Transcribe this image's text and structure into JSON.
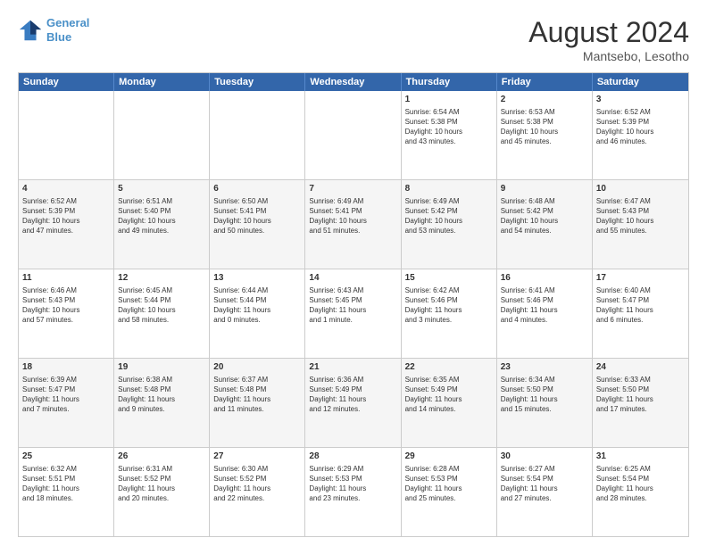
{
  "logo": {
    "line1": "General",
    "line2": "Blue"
  },
  "header": {
    "month_year": "August 2024",
    "location": "Mantsebo, Lesotho"
  },
  "days": [
    "Sunday",
    "Monday",
    "Tuesday",
    "Wednesday",
    "Thursday",
    "Friday",
    "Saturday"
  ],
  "rows": [
    [
      {
        "day": "",
        "content": ""
      },
      {
        "day": "",
        "content": ""
      },
      {
        "day": "",
        "content": ""
      },
      {
        "day": "",
        "content": ""
      },
      {
        "day": "1",
        "content": "Sunrise: 6:54 AM\nSunset: 5:38 PM\nDaylight: 10 hours\nand 43 minutes."
      },
      {
        "day": "2",
        "content": "Sunrise: 6:53 AM\nSunset: 5:38 PM\nDaylight: 10 hours\nand 45 minutes."
      },
      {
        "day": "3",
        "content": "Sunrise: 6:52 AM\nSunset: 5:39 PM\nDaylight: 10 hours\nand 46 minutes."
      }
    ],
    [
      {
        "day": "4",
        "content": "Sunrise: 6:52 AM\nSunset: 5:39 PM\nDaylight: 10 hours\nand 47 minutes."
      },
      {
        "day": "5",
        "content": "Sunrise: 6:51 AM\nSunset: 5:40 PM\nDaylight: 10 hours\nand 49 minutes."
      },
      {
        "day": "6",
        "content": "Sunrise: 6:50 AM\nSunset: 5:41 PM\nDaylight: 10 hours\nand 50 minutes."
      },
      {
        "day": "7",
        "content": "Sunrise: 6:49 AM\nSunset: 5:41 PM\nDaylight: 10 hours\nand 51 minutes."
      },
      {
        "day": "8",
        "content": "Sunrise: 6:49 AM\nSunset: 5:42 PM\nDaylight: 10 hours\nand 53 minutes."
      },
      {
        "day": "9",
        "content": "Sunrise: 6:48 AM\nSunset: 5:42 PM\nDaylight: 10 hours\nand 54 minutes."
      },
      {
        "day": "10",
        "content": "Sunrise: 6:47 AM\nSunset: 5:43 PM\nDaylight: 10 hours\nand 55 minutes."
      }
    ],
    [
      {
        "day": "11",
        "content": "Sunrise: 6:46 AM\nSunset: 5:43 PM\nDaylight: 10 hours\nand 57 minutes."
      },
      {
        "day": "12",
        "content": "Sunrise: 6:45 AM\nSunset: 5:44 PM\nDaylight: 10 hours\nand 58 minutes."
      },
      {
        "day": "13",
        "content": "Sunrise: 6:44 AM\nSunset: 5:44 PM\nDaylight: 11 hours\nand 0 minutes."
      },
      {
        "day": "14",
        "content": "Sunrise: 6:43 AM\nSunset: 5:45 PM\nDaylight: 11 hours\nand 1 minute."
      },
      {
        "day": "15",
        "content": "Sunrise: 6:42 AM\nSunset: 5:46 PM\nDaylight: 11 hours\nand 3 minutes."
      },
      {
        "day": "16",
        "content": "Sunrise: 6:41 AM\nSunset: 5:46 PM\nDaylight: 11 hours\nand 4 minutes."
      },
      {
        "day": "17",
        "content": "Sunrise: 6:40 AM\nSunset: 5:47 PM\nDaylight: 11 hours\nand 6 minutes."
      }
    ],
    [
      {
        "day": "18",
        "content": "Sunrise: 6:39 AM\nSunset: 5:47 PM\nDaylight: 11 hours\nand 7 minutes."
      },
      {
        "day": "19",
        "content": "Sunrise: 6:38 AM\nSunset: 5:48 PM\nDaylight: 11 hours\nand 9 minutes."
      },
      {
        "day": "20",
        "content": "Sunrise: 6:37 AM\nSunset: 5:48 PM\nDaylight: 11 hours\nand 11 minutes."
      },
      {
        "day": "21",
        "content": "Sunrise: 6:36 AM\nSunset: 5:49 PM\nDaylight: 11 hours\nand 12 minutes."
      },
      {
        "day": "22",
        "content": "Sunrise: 6:35 AM\nSunset: 5:49 PM\nDaylight: 11 hours\nand 14 minutes."
      },
      {
        "day": "23",
        "content": "Sunrise: 6:34 AM\nSunset: 5:50 PM\nDaylight: 11 hours\nand 15 minutes."
      },
      {
        "day": "24",
        "content": "Sunrise: 6:33 AM\nSunset: 5:50 PM\nDaylight: 11 hours\nand 17 minutes."
      }
    ],
    [
      {
        "day": "25",
        "content": "Sunrise: 6:32 AM\nSunset: 5:51 PM\nDaylight: 11 hours\nand 18 minutes."
      },
      {
        "day": "26",
        "content": "Sunrise: 6:31 AM\nSunset: 5:52 PM\nDaylight: 11 hours\nand 20 minutes."
      },
      {
        "day": "27",
        "content": "Sunrise: 6:30 AM\nSunset: 5:52 PM\nDaylight: 11 hours\nand 22 minutes."
      },
      {
        "day": "28",
        "content": "Sunrise: 6:29 AM\nSunset: 5:53 PM\nDaylight: 11 hours\nand 23 minutes."
      },
      {
        "day": "29",
        "content": "Sunrise: 6:28 AM\nSunset: 5:53 PM\nDaylight: 11 hours\nand 25 minutes."
      },
      {
        "day": "30",
        "content": "Sunrise: 6:27 AM\nSunset: 5:54 PM\nDaylight: 11 hours\nand 27 minutes."
      },
      {
        "day": "31",
        "content": "Sunrise: 6:25 AM\nSunset: 5:54 PM\nDaylight: 11 hours\nand 28 minutes."
      }
    ]
  ]
}
